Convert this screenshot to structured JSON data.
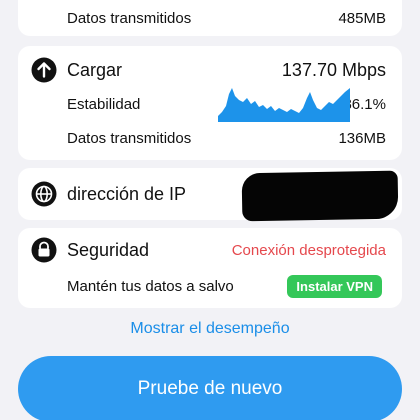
{
  "download_tail": {
    "transmitted_label": "Datos transmitidos",
    "transmitted_value": "485MB"
  },
  "upload": {
    "title": "Cargar",
    "speed": "137.70 Mbps",
    "stability_label": "Estabilidad",
    "stability_value": "86.1%",
    "transmitted_label": "Datos transmitidos",
    "transmitted_value": "136MB",
    "icon": "arrow-up-circle-icon",
    "accent": "#2f9bf0"
  },
  "ip": {
    "title": "dirección de IP",
    "icon": "globe-icon"
  },
  "security": {
    "title": "Seguridad",
    "status": "Conexión desprotegida",
    "status_color": "#e5484d",
    "tip": "Mantén tus datos a salvo",
    "vpn_button": "Instalar VPN",
    "vpn_color": "#34c759",
    "icon": "lock-icon"
  },
  "show_performance": "Mostrar el desempeño",
  "retry_button": "Pruebe de nuevo"
}
